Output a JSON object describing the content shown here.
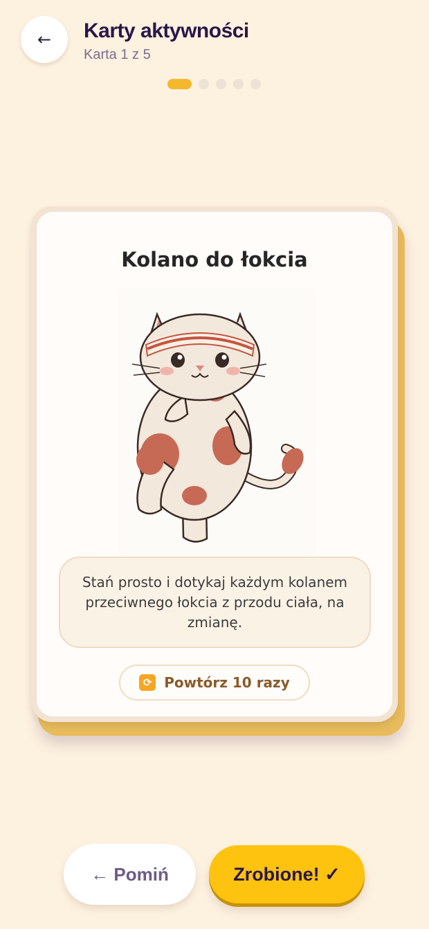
{
  "header": {
    "back_icon": "←",
    "title": "Karty aktywności",
    "subtitle": "Karta 1 z 5"
  },
  "progress": {
    "current": 1,
    "total": 5
  },
  "card": {
    "title": "Kolano do łokcia",
    "illustration": "cat-exercise-illustration",
    "description": "Stań prosto i dotykaj każdym kolanem przeciwnego łokcia z przodu ciała, na zmianę.",
    "reps_icon": "🔁",
    "reps_label": "Powtórz 10 razy"
  },
  "actions": {
    "skip_label": "← Pomiń",
    "done_label": "Zrobione! ✓"
  },
  "colors": {
    "background": "#fdf1e0",
    "accent": "#fdc30f",
    "active_dot": "#f4b82e",
    "title": "#2a1747"
  }
}
